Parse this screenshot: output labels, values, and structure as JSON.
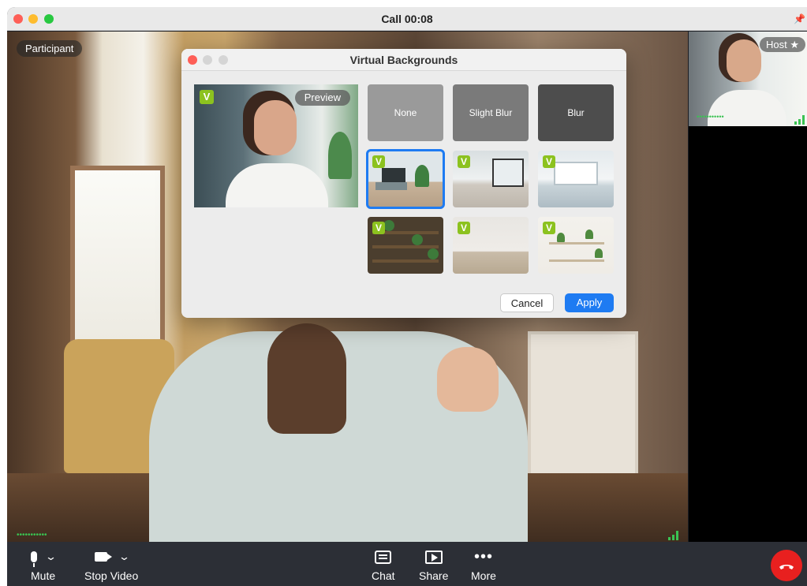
{
  "window": {
    "title": "Call 00:08"
  },
  "main_video": {
    "participant_label": "Participant",
    "signal_dots": "•••••••••••"
  },
  "host_tile": {
    "label": "Host ★",
    "signal_dots": "•••••••••••"
  },
  "toolbar": {
    "mute_label": "Mute",
    "stop_video_label": "Stop Video",
    "chat_label": "Chat",
    "share_label": "Share",
    "more_label": "More"
  },
  "dialog": {
    "title": "Virtual Backgrounds",
    "preview_label": "Preview",
    "badge_letter": "V",
    "tiles": [
      {
        "label": "None"
      },
      {
        "label": "Slight Blur"
      },
      {
        "label": "Blur"
      }
    ],
    "cancel_label": "Cancel",
    "apply_label": "Apply"
  },
  "colors": {
    "accent": "#1e7bf2",
    "end_call": "#e8201f",
    "badge": "#8cc21f",
    "signal": "#3ac252"
  },
  "icons": [
    "microphone-icon",
    "camera-icon",
    "chat-icon",
    "share-screen-icon",
    "more-icon",
    "end-call-icon",
    "pin-icon"
  ]
}
